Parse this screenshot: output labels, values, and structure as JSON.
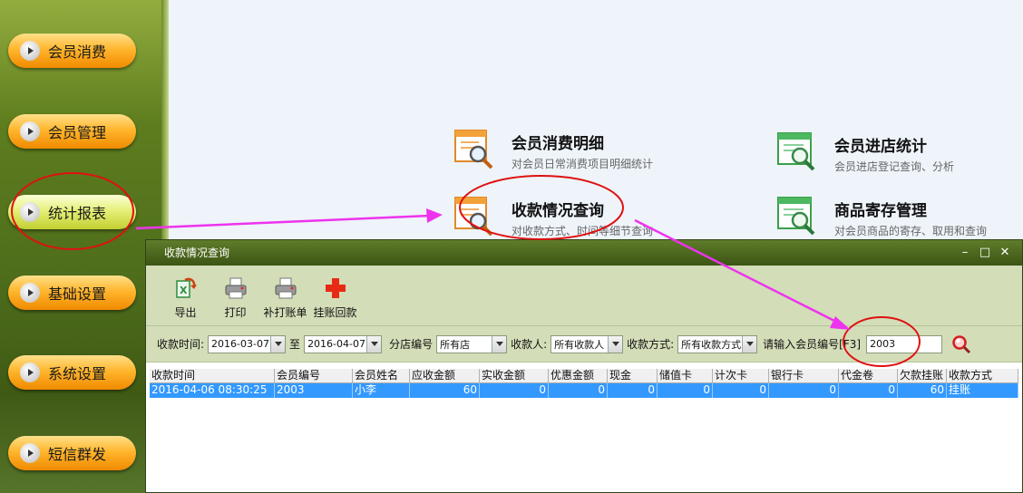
{
  "sidebar": {
    "items": [
      {
        "label": "会员消费"
      },
      {
        "label": "会员管理"
      },
      {
        "label": "统计报表"
      },
      {
        "label": "基础设置"
      },
      {
        "label": "系统设置"
      },
      {
        "label": "短信群发"
      }
    ]
  },
  "reports": {
    "consumption_detail": {
      "title": "会员消费明细",
      "desc": "对会员日常消费项目明细统计"
    },
    "store_visit": {
      "title": "会员进店统计",
      "desc": "会员进店登记查询、分析"
    },
    "payment_query": {
      "title": "收款情况查询",
      "desc": "对收款方式、时间等细节查询"
    },
    "storage_mgmt": {
      "title": "商品寄存管理",
      "desc": "对会员商品的寄存、取用和查询"
    }
  },
  "dialog": {
    "title": "收款情况查询",
    "controls": {
      "minimize": "–",
      "maximize": "□",
      "close": "✕"
    },
    "toolbar": [
      {
        "label": "导出",
        "icon": "export-icon"
      },
      {
        "label": "打印",
        "icon": "printer-icon"
      },
      {
        "label": "补打账单",
        "icon": "reprint-icon"
      },
      {
        "label": "挂账回款",
        "icon": "add-cross-icon"
      }
    ],
    "filters": {
      "time_label": "收款时间:",
      "date_from": "2016-03-07",
      "to_label": "至",
      "date_to": "2016-04-07",
      "branch_label": "分店编号",
      "branch_value": "所有店",
      "cashier_label": "收款人:",
      "cashier_value": "所有收款人",
      "method_label": "收款方式:",
      "method_value": "所有收款方式",
      "member_label": "请输入会员编号[F3]",
      "member_value": "2003"
    },
    "table": {
      "headers": [
        "收款时间",
        "会员编号",
        "会员姓名",
        "应收金额",
        "实收金额",
        "优惠金额",
        "现金",
        "储值卡",
        "计次卡",
        "银行卡",
        "代金卷",
        "欠款挂账",
        "收款方式"
      ],
      "rows": [
        [
          "2016-04-06 08:30:25",
          "2003",
          "小李",
          "60",
          "0",
          "0",
          "0",
          "0",
          "0",
          "0",
          "0",
          "60",
          "挂账"
        ]
      ]
    }
  },
  "colors": {
    "accent_annotation": "#e01010",
    "arrow": "#ee33ee",
    "selection": "#3399ff"
  }
}
